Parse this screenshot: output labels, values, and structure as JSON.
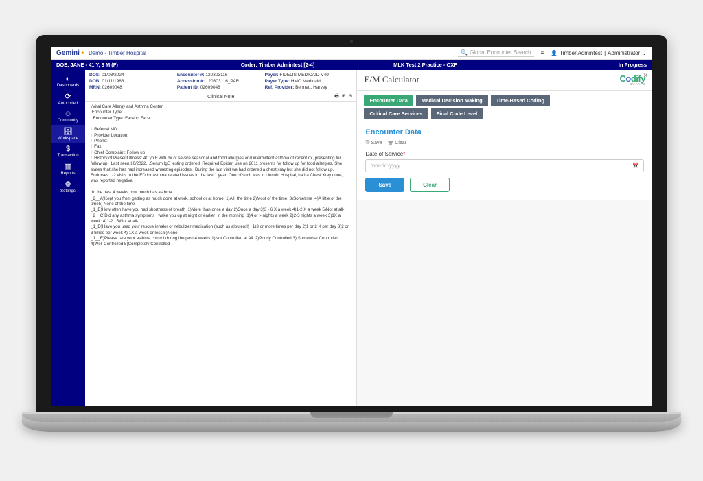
{
  "topbar": {
    "logo": "Gemini",
    "demo": "Demo - Timber Hospital",
    "search_placeholder": "Global Encounter Search",
    "user": "Timber Admintest",
    "role": "Administrator"
  },
  "patient_bar": {
    "name": "DOE, JANE - 41 Y, 3 M (F)",
    "coder": "Coder: Timber Admintest [2-4]",
    "practice": "MLK Test 2 Practice - OXF",
    "status": "In Progress"
  },
  "sidebar": {
    "items": [
      {
        "icon": "◐",
        "label": "Dashboards"
      },
      {
        "icon": "⟳",
        "label": "Autocoded"
      },
      {
        "icon": "☺",
        "label": "Community"
      },
      {
        "icon": "🗄",
        "label": "Workspace"
      },
      {
        "icon": "$",
        "label": "Transaction"
      },
      {
        "icon": "▥",
        "label": "Reports"
      },
      {
        "icon": "⚙",
        "label": "Settings"
      }
    ]
  },
  "meta": {
    "rows": [
      [
        {
          "k": "DOS:",
          "v": "01/03/2024"
        },
        {
          "k": "Encounter #:",
          "v": "120303116"
        },
        {
          "k": "Payer:",
          "v": "FIDELIS MEDICAID V49"
        }
      ],
      [
        {
          "k": "DOB:",
          "v": "01/11/1983"
        },
        {
          "k": "Accession #:",
          "v": "120303116_PAR…"
        },
        {
          "k": "Payer Type:",
          "v": "HMO Medicaid"
        }
      ],
      [
        {
          "k": "MRN:",
          "v": "02609048"
        },
        {
          "k": "Patient ID:",
          "v": "02609048"
        },
        {
          "k": "Ref. Provider:",
          "v": "Bennett, Harvey"
        }
      ]
    ]
  },
  "note": {
    "title": "Clinical Note",
    "body": "\\'Vital Care Allergy and Asthma Center:\n Encounter Type:\n  Encounter Type: Face to Face\n\nI  Referral MD:\nI  Provider Location:\nI  Phone:\nI  Fax:\nI  Chief Complaint: Follow up\nI  History of Present Illness: 40 yo F with hx of severe seasonal and food allergies and intermittent asthma of recent dx, presenting for follow up.  Last seen 10/2022…Serum IgE testing ordered. Required Epipen use on 2011 presents for follow up for food allergies. She states that she has had increased wheezing episodes.  During the last visit we had ordered a chest xray but she did not follow up.\nEndorses 1-2 visits to the ED for asthma related issues in the last 1 year. One of such was in Lincoln Hospital, had a Chest Xray done, was reported negative.\n\n In the past 4 weeks how much has asthma\n_2__A)Kept you from getting as much done at work, school or at home  1)All  the time 2)Most of the time  3)Sometime  4)A little of the time5) None of the time-\n_1_B)How often have you had shortness of breath  1)More than once a day 2)Once a day 3)3 - 6 X a week 4)1-2 X a week 5)Not at all-\n_2__C)Did any asthma symptoms   wake you up at night or earlier  in the morning  1)4 or > nights a week 2)2-3 nights a week 3)1X a week  4)1-2   5)Not at all-\n_1_D)Have you used your rescue inhaler or nebulizer medication (such as albuterol)   1)3 or more times per day 2)1 or 2 X per day 3)2 or 3 times per week 4) 1X a week or less 5)None\n_1__E)Please rate your asthma control during the past 4 weeks 1)Not Controlled at All  2)Poorly Controlled 3) Somewhat Controlled 4)Well Controlled 5)Completely Controlled-"
  },
  "calc": {
    "title": "E/M Calculator",
    "brand": "Codify",
    "brand_sub": "BY AAPC",
    "tabs1": [
      "Encounter Data",
      "Medical Decision Making",
      "Time-Based Coding"
    ],
    "tabs2": [
      "Critical Care Services",
      "Final Code Level"
    ],
    "section": "Encounter Data",
    "mini_save": "Save",
    "mini_clear": "Clear",
    "date_label": "Date of Service",
    "date_placeholder": "mm-dd-yyyy",
    "save": "Save",
    "clear": "Clear"
  }
}
